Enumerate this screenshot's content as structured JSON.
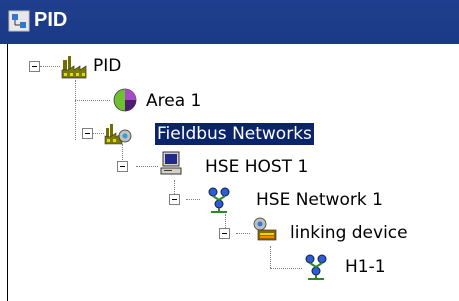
{
  "window": {
    "title": "PID",
    "title_icon": "pid-window-icon"
  },
  "tree": {
    "nodes": [
      {
        "label": "PID",
        "icon": "plant-icon"
      },
      {
        "label": "Area 1",
        "icon": "area-pie-icon"
      },
      {
        "label": "Fieldbus Networks",
        "icon": "fieldbus-networks-icon",
        "selected": true
      },
      {
        "label": "HSE HOST 1",
        "icon": "computer-host-icon"
      },
      {
        "label": "HSE Network 1",
        "icon": "network-icon"
      },
      {
        "label": "linking device",
        "icon": "linking-device-icon"
      },
      {
        "label": "H1-1",
        "icon": "network-icon"
      }
    ]
  },
  "colors": {
    "titlebar": "#1f3f8e",
    "selection": "#0a246a"
  }
}
